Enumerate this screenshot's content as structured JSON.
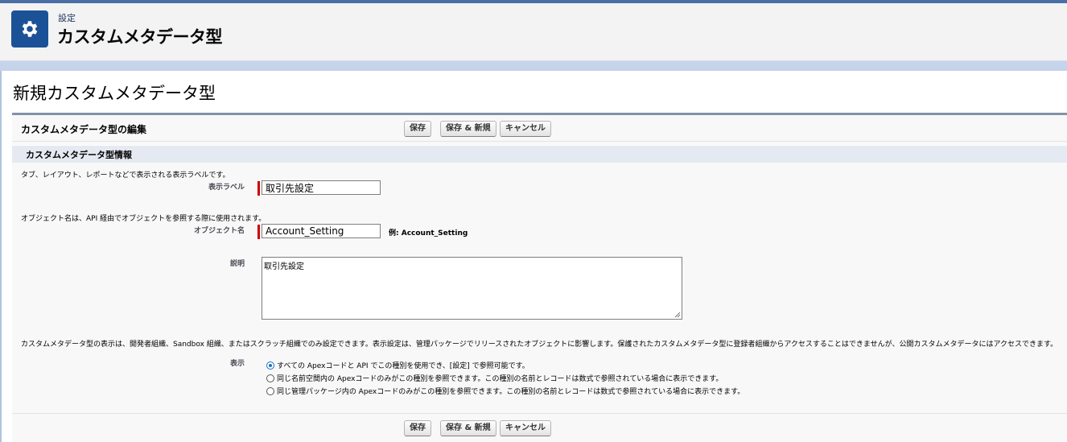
{
  "header": {
    "breadcrumb": "設定",
    "title": "カスタムメタデータ型",
    "icon": "gear-icon"
  },
  "page_title": "新規カスタムメタデータ型",
  "edit_block": {
    "title": "カスタムメタデータ型の編集",
    "save_label": "保存",
    "save_new_label": "保存 & 新規",
    "cancel_label": "キャンセル"
  },
  "section": {
    "title": "カスタムメタデータ型情報",
    "label_help": "タブ、レイアウト、レポートなどで表示される表示ラベルです。",
    "label_field_label": "表示ラベル",
    "label_value": "取引先設定",
    "object_help": "オブジェクト名は、API 経由でオブジェクトを参照する際に使用されます。",
    "object_field_label": "オブジェクト名",
    "object_value": "Account_Setting",
    "object_example": "例:  Account_Setting",
    "description_label": "説明",
    "description_value": "取引先設定",
    "visibility_help": "カスタムメタデータ型の表示は、開発者組織、Sandbox 組織、またはスクラッチ組織でのみ設定できます。表示設定は、管理パッケージでリリースされたオブジェクトに影響します。保護されたカスタムメタデータ型に登録者組織からアクセスすることはできませんが、公開カスタムメタデータにはアクセスできます。",
    "visibility_label": "表示",
    "visibility_options": [
      "すべての Apexコードと API でこの種別を使用でき、[設定] で参照可能です。",
      "同じ名前空間内の Apexコードのみがこの種別を参照できます。この種別の名前とレコードは数式で参照されている場合に表示できます。",
      "同じ管理パッケージ内の Apexコードのみがこの種別を参照できます。この種別の名前とレコードは数式で参照されている場合に表示できます。"
    ],
    "selected_option": 0
  },
  "colors": {
    "accent": "#1b5297",
    "required": "#cc0000",
    "block_border": "#8192a9"
  }
}
